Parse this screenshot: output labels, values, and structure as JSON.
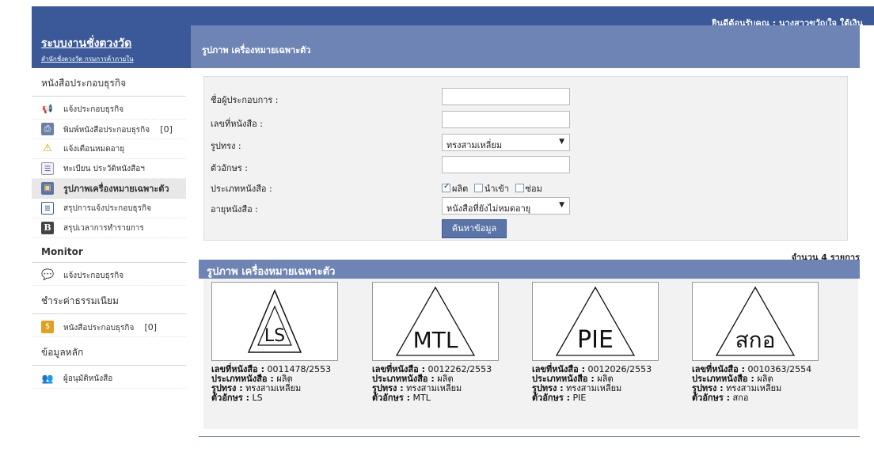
{
  "topbar": {
    "welcome": "ยินดีต้อนรับคุณ : นางสาวขวัญใจ ใต้เงิน"
  },
  "brand": {
    "title": "ระบบงานชั่งตวงวัด",
    "subtitle": "สำนักชั่งตวงวัด กรมการค้าภายใน"
  },
  "sidebar": {
    "sections": [
      {
        "title": "หนังสือประกอบธุรกิจ"
      },
      {
        "title": "Monitor"
      },
      {
        "title": "ชำระค่าธรรมเนียม"
      },
      {
        "title": "ข้อมูลหลัก"
      }
    ],
    "items": [
      {
        "label": "แจ้งประกอบธุรกิจ",
        "icon": "megaphone-icon"
      },
      {
        "label": "พิมพ์หนังสือประกอบธุรกิจ",
        "icon": "printer-icon",
        "count": "[0]"
      },
      {
        "label": "แจ้งเตือนหมดอายุ",
        "icon": "warning-icon"
      },
      {
        "label": "ทะเบียน ประวัติหนังสือฯ",
        "icon": "register-icon"
      },
      {
        "label": "รูปภาพเครื่องหมายเฉพาะตัว",
        "icon": "picture-icon"
      },
      {
        "label": "สรุปการแจ้งประกอบธุรกิจ",
        "icon": "report-icon"
      },
      {
        "label": "สรุปเวลาการทำรายการ",
        "icon": "b-icon"
      },
      {
        "label": "แจ้งประกอบธุรกิจ",
        "icon": "chat-icon"
      },
      {
        "label": "หนังสือประกอบธุรกิจ",
        "icon": "money-icon",
        "count": "[0]"
      },
      {
        "label": "ผู้อนุมัติหนังสือ",
        "icon": "users-icon"
      }
    ]
  },
  "main": {
    "title": "รูปภาพ เครื่องหมายเฉพาะตัว",
    "form": {
      "operator_label": "ชื่อผู้ประกอบการ :",
      "doc_no_label": "เลขที่หนังสือ :",
      "shape_label": "รูปทรง :",
      "shape_value": "ทรงสามเหลี่ยม",
      "letters_label": "ตัวอักษร :",
      "doc_type_label": "ประเภทหนังสือ :",
      "check_produce": "ผลิต",
      "check_import": "นำเข้า",
      "check_repair": "ซ่อม",
      "doc_age_label": "อายุหนังสือ :",
      "doc_age_value": "หนังสือที่ยังไม่หมดอายุ",
      "search_button": "ค้นหาข้อมูล"
    },
    "result_count": "จำนวน 4 รายการ",
    "result_title": "รูปภาพ เครื่องหมายเฉพาะตัว",
    "labels": {
      "doc_no": "เลขที่หนังสือ :",
      "doc_type": "ประเภทหนังสือ :",
      "shape": "รูปทรง :",
      "letters": "ตัวอักษร :"
    },
    "cards": [
      {
        "doc_no": "0011478/2553",
        "doc_type": "ผลิต",
        "shape": "ทรงสามเหลี่ยม",
        "letters": "LS",
        "mark": "LS"
      },
      {
        "doc_no": "0012262/2553",
        "doc_type": "ผลิต",
        "shape": "ทรงสามเหลี่ยม",
        "letters": "MTL",
        "mark": "MTL"
      },
      {
        "doc_no": "0012026/2553",
        "doc_type": "ผลิต",
        "shape": "ทรงสามเหลี่ยม",
        "letters": "PIE",
        "mark": "PIE"
      },
      {
        "doc_no": "0010363/2554",
        "doc_type": "ผลิต",
        "shape": "ทรงสามเหลี่ยม",
        "letters": "สกอ",
        "mark": "สกอ"
      }
    ]
  }
}
